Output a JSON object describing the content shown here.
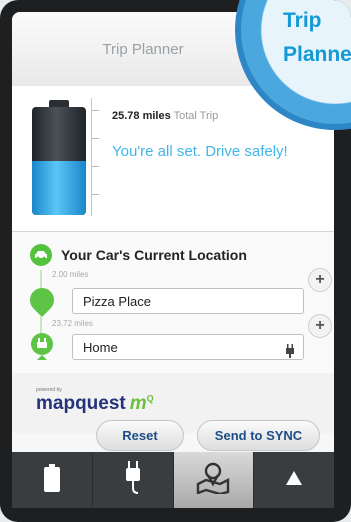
{
  "header": {
    "title": "Trip Planner"
  },
  "badge": {
    "line1": "Trip",
    "line2": "Planner"
  },
  "summary": {
    "distance_value": "25.78 miles",
    "distance_suffix": "Total Trip",
    "status": "You're all set. Drive safely!",
    "battery_level": 0.5
  },
  "locations": {
    "title": "Your Car's Current Location",
    "stops": [
      {
        "distance": "2.00 miles",
        "name": "Pizza Place"
      },
      {
        "distance": "23.72 miles",
        "name": "Home"
      }
    ]
  },
  "brand": {
    "powered_by": "powered by",
    "name": "mapquest",
    "suffix": "m",
    "superscript": "Q"
  },
  "buttons": {
    "reset": "Reset",
    "send": "Send to SYNC"
  },
  "tabs": [
    {
      "icon": "battery-icon",
      "active": false
    },
    {
      "icon": "plug-icon",
      "active": false
    },
    {
      "icon": "map-pin-icon",
      "active": true
    },
    {
      "icon": "triangle-up-icon",
      "active": false
    }
  ],
  "colors": {
    "accent": "#43b6e8",
    "green": "#5ec445",
    "navy": "#1e4d87",
    "tabbar": "#3a3d40"
  }
}
